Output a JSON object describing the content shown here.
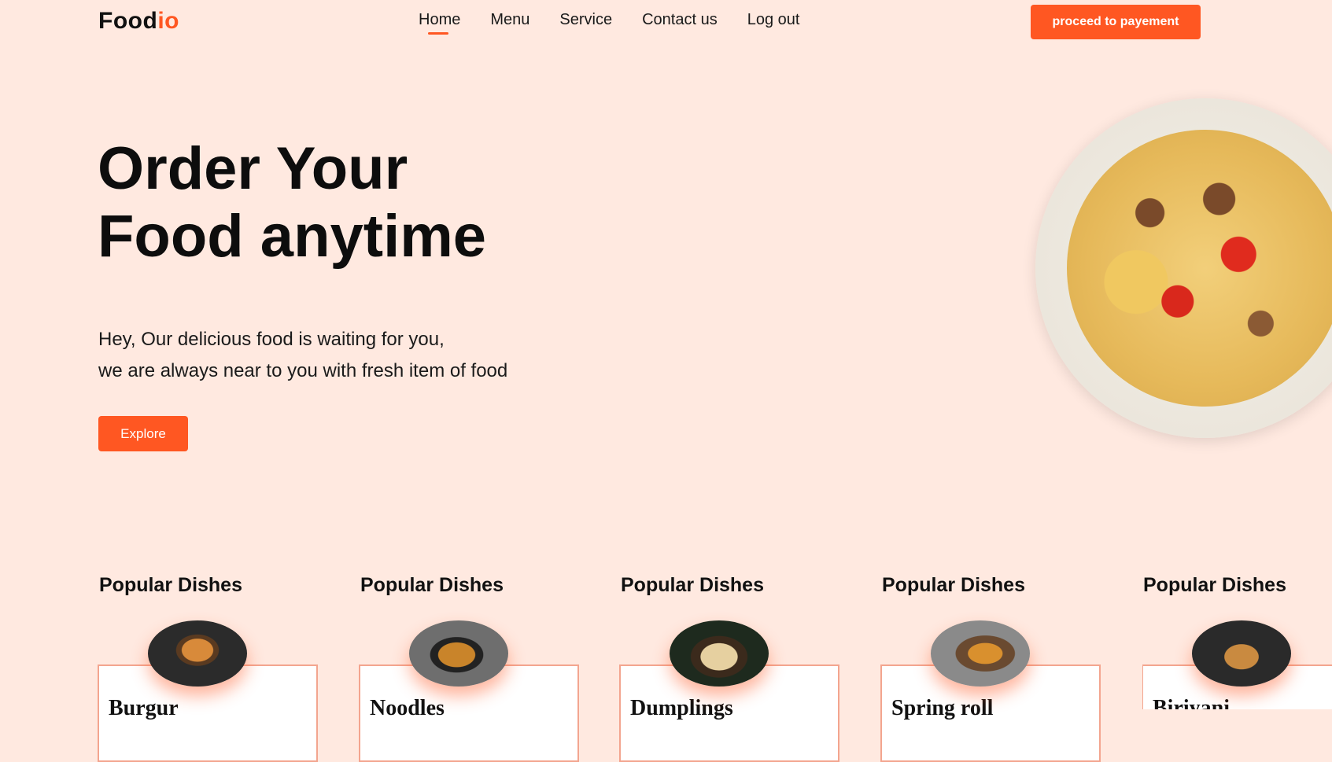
{
  "brand": {
    "name_main": "Food",
    "name_accent": "io",
    "accent_color": "#ff5722"
  },
  "nav": {
    "items": [
      {
        "label": "Home",
        "active": true
      },
      {
        "label": "Menu"
      },
      {
        "label": "Service"
      },
      {
        "label": "Contact us"
      },
      {
        "label": "Log out"
      }
    ],
    "cta_label": "proceed to payement"
  },
  "hero": {
    "title_line1": "Order Your",
    "title_line2": "Food anytime",
    "subtitle_line1": "Hey, Our delicious food is waiting for you,",
    "subtitle_line2": "we are always near to you with fresh item of food",
    "explore_label": "Explore",
    "image_icon": "noodle-plate-image"
  },
  "dishes": [
    {
      "heading": "Popular Dishes",
      "name": "Burgur",
      "icon": "burger-image"
    },
    {
      "heading": "Popular Dishes",
      "name": "Noodles",
      "icon": "noodles-image"
    },
    {
      "heading": "Popular Dishes",
      "name": "Dumplings",
      "icon": "dumplings-image"
    },
    {
      "heading": "Popular Dishes",
      "name": "Spring roll",
      "icon": "spring-roll-image"
    },
    {
      "heading": "Popular Dishes",
      "name": "Biriyani",
      "icon": "biriyani-image"
    }
  ],
  "colors": {
    "background": "#ffe9e0",
    "card_border": "#f3a58f"
  }
}
